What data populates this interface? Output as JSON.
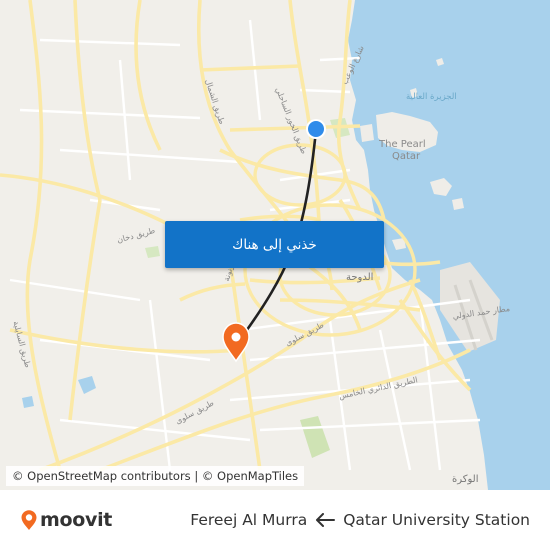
{
  "map": {
    "labels": {
      "island_label": "الجزيرة العالية",
      "pearl_line1": "The Pearl",
      "pearl_line2": "Qatar",
      "road_wakra_coast": "طريق الخور الساحلي",
      "road_shamal": "طريق الشمال",
      "road_onaiza": "شارع الوعب",
      "road_dukhan": "طريق دخان",
      "road_doha_city": "الدوحة",
      "road_airport": "مطار حمد الدولي",
      "road_qaroosa": "شارع القرنونة",
      "road_salwa_1": "طريق سلوى",
      "road_salwa_2": "طريق سلوى",
      "road_ring5": "الطريق الدائري الخامس",
      "road_saidi": "طريق السايلية",
      "town_wakra": "الوكرة"
    },
    "origin_marker_color": "#2f8bea",
    "destination_marker_color": "#f26a21",
    "route_line_color": "#222222",
    "water_color": "#a8d1ec"
  },
  "cta": {
    "label": "خذني إلى هناك"
  },
  "attribution": {
    "text": "© OpenStreetMap contributors | © OpenMapTiles"
  },
  "footer": {
    "logo_text": "moovit",
    "brand_color": "#f26a21",
    "destination": "Fereej Al Murra",
    "origin": "Qatar University Station"
  }
}
